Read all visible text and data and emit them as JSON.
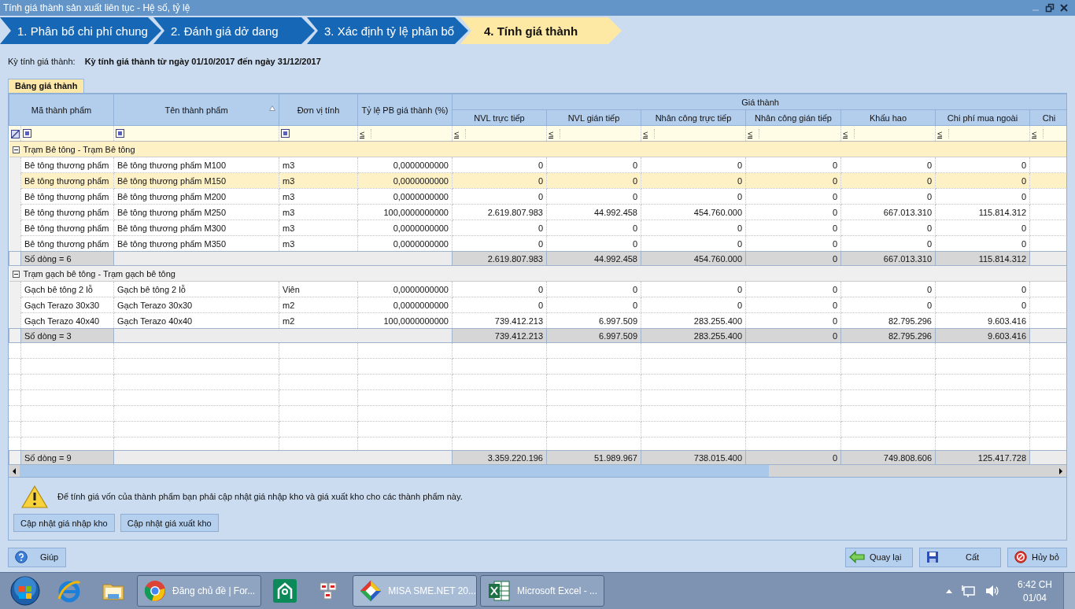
{
  "window": {
    "title": "Tính giá thành sản xuất liên tục - Hệ số, tỷ lệ",
    "minimize_disabled": true
  },
  "steps": [
    {
      "label": "1. Phân bổ chi phí chung",
      "selected": false
    },
    {
      "label": "2. Đánh giá dở dang",
      "selected": false
    },
    {
      "label": "3. Xác định tỷ lệ phân bổ",
      "selected": false
    },
    {
      "label": "4. Tính giá thành",
      "selected": true
    }
  ],
  "period": {
    "label": "Kỳ tính giá thành:",
    "value": "Kỳ tính giá thành từ ngày 01/10/2017 đến ngày 31/12/2017"
  },
  "tabs": [
    {
      "label": "Bảng giá thành",
      "selected": true
    }
  ],
  "grid": {
    "columns": [
      {
        "label": "Mã thành phẩm",
        "sorted": false,
        "filter": {
          "kind": "checkbox"
        }
      },
      {
        "label": "Tên thành phẩm",
        "sorted": true,
        "filter": {
          "kind": "checkbox"
        }
      },
      {
        "label": "Đơn vị tính",
        "sorted": false,
        "filter": {
          "kind": "checkbox"
        }
      },
      {
        "label": "Tỷ lệ PB giá thành (%)",
        "sorted": false,
        "filter": {
          "kind": "operator",
          "text": "≤"
        }
      }
    ],
    "column_group": {
      "label": "Giá thành",
      "columns": [
        {
          "label": "NVL trực tiếp",
          "filter": {
            "kind": "operator",
            "text": "≤"
          }
        },
        {
          "label": "NVL gián tiếp",
          "filter": {
            "kind": "operator",
            "text": "≤"
          }
        },
        {
          "label": "Nhân công trực tiếp",
          "filter": {
            "kind": "operator",
            "text": "≤"
          }
        },
        {
          "label": "Nhân công gián tiếp",
          "filter": {
            "kind": "operator",
            "text": "≤"
          }
        },
        {
          "label": "Khấu hao",
          "filter": {
            "kind": "operator",
            "text": "≤"
          }
        },
        {
          "label": "Chi phí mua ngoài",
          "filter": {
            "kind": "operator",
            "text": "≤"
          }
        },
        {
          "label": "Chi",
          "filter": {
            "kind": "operator",
            "text": "≤"
          }
        }
      ]
    },
    "groups": [
      {
        "label": "Trạm Bê tông - Trạm Bê tông",
        "expanded": true,
        "selected": true,
        "rows": [
          {
            "selected": false,
            "cells": [
              "Bê tông thương phẩm",
              "Bê tông thương phẩm M100",
              "m3",
              "0,0000000000",
              "0",
              "0",
              "0",
              "0",
              "0",
              "0"
            ]
          },
          {
            "selected": true,
            "cells": [
              "Bê tông thương phẩm",
              "Bê tông thương phẩm M150",
              "m3",
              "0,0000000000",
              "0",
              "0",
              "0",
              "0",
              "0",
              "0"
            ]
          },
          {
            "selected": false,
            "cells": [
              "Bê tông thương phẩm",
              "Bê tông thương phẩm M200",
              "m3",
              "0,0000000000",
              "0",
              "0",
              "0",
              "0",
              "0",
              "0"
            ]
          },
          {
            "selected": false,
            "cells": [
              "Bê tông thương phẩm",
              "Bê tông thương phẩm M250",
              "m3",
              "100,0000000000",
              "2.619.807.983",
              "44.992.458",
              "454.760.000",
              "0",
              "667.013.310",
              "115.814.312"
            ]
          },
          {
            "selected": false,
            "cells": [
              "Bê tông thương phẩm",
              "Bê tông thương phẩm M300",
              "m3",
              "0,0000000000",
              "0",
              "0",
              "0",
              "0",
              "0",
              "0"
            ]
          },
          {
            "selected": false,
            "cells": [
              "Bê tông thương phẩm",
              "Bê tông thương phẩm M350",
              "m3",
              "0,0000000000",
              "0",
              "0",
              "0",
              "0",
              "0",
              "0"
            ]
          }
        ],
        "summary": {
          "label": "Số dòng = 6",
          "values": [
            "2.619.807.983",
            "44.992.458",
            "454.760.000",
            "0",
            "667.013.310",
            "115.814.312"
          ]
        }
      },
      {
        "label": "Trạm gạch bê tông - Trạm gạch bê tông",
        "expanded": true,
        "selected": false,
        "rows": [
          {
            "selected": false,
            "cells": [
              "Gạch bê tông 2 lỗ",
              "Gạch bê tông 2 lỗ",
              "Viên",
              "0,0000000000",
              "0",
              "0",
              "0",
              "0",
              "0",
              "0"
            ]
          },
          {
            "selected": false,
            "cells": [
              "Gạch Terazo 30x30",
              "Gạch Terazo 30x30",
              "m2",
              "0,0000000000",
              "0",
              "0",
              "0",
              "0",
              "0",
              "0"
            ]
          },
          {
            "selected": false,
            "cells": [
              "Gạch Terazo 40x40",
              "Gạch Terazo 40x40",
              "m2",
              "100,0000000000",
              "739.412.213",
              "6.997.509",
              "283.255.400",
              "0",
              "82.795.296",
              "9.603.416"
            ]
          }
        ],
        "summary": {
          "label": "Số dòng = 3",
          "values": [
            "739.412.213",
            "6.997.509",
            "283.255.400",
            "0",
            "82.795.296",
            "9.603.416"
          ]
        }
      }
    ],
    "total": {
      "label": "Số dòng = 9",
      "values": [
        "3.359.220.196",
        "51.989.967",
        "738.015.400",
        "0",
        "749.808.606",
        "125.417.728"
      ]
    }
  },
  "notice": {
    "text": "Để tính giá vốn của thành phẩm bạn phải cập nhật giá nhập kho và giá xuất kho cho các thành phẩm này.",
    "buttons": [
      "Cập nhật giá nhập kho",
      "Cập nhật giá xuất kho"
    ]
  },
  "footer": {
    "help": "Giúp",
    "back": "Quay lại",
    "save": "Cất",
    "cancel": "Hủy bỏ"
  },
  "taskbar": {
    "items": [
      {
        "running": false,
        "selected": false
      },
      {
        "running": false,
        "selected": false
      },
      {
        "running": false,
        "selected": false
      },
      {
        "running": true,
        "selected": false,
        "label": "Đăng chủ đề | For..."
      },
      {
        "running": false,
        "selected": false
      },
      {
        "running": false,
        "selected": false
      },
      {
        "running": true,
        "selected": true,
        "label": "MISA SME.NET 20..."
      },
      {
        "running": true,
        "selected": false,
        "label": "Microsoft Excel - ..."
      }
    ],
    "time": "6:42 CH",
    "date": "01/04"
  }
}
